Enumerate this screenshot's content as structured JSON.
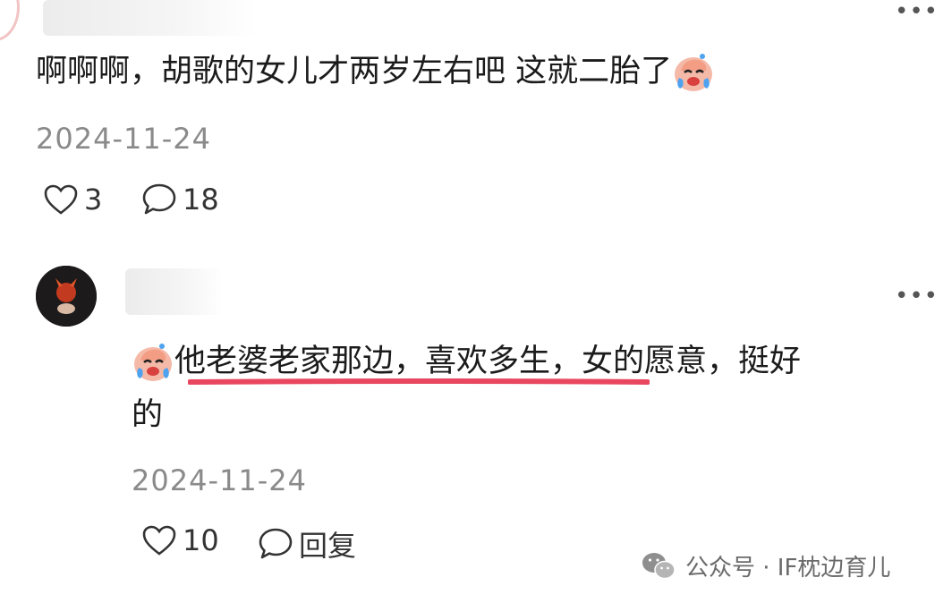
{
  "comment_1": {
    "text": "啊啊啊，胡歌的女儿才两岁左右吧 这就二胎了",
    "emoji": "crying-face-icon",
    "date": "2024-11-24",
    "likes": "3",
    "replies": "18"
  },
  "comment_2": {
    "lead_text": "他老婆老家那边，喜欢多生，",
    "tail_text": "女的愿意，挺好",
    "line2_text": "的",
    "emoji": "crying-face-icon",
    "date": "2024-11-24",
    "likes": "10",
    "reply_label": "回复"
  },
  "watermark": {
    "text": "公众号 · IF枕边育儿"
  },
  "colors": {
    "highlight": "#e8475f",
    "date": "#8a8a8a"
  }
}
